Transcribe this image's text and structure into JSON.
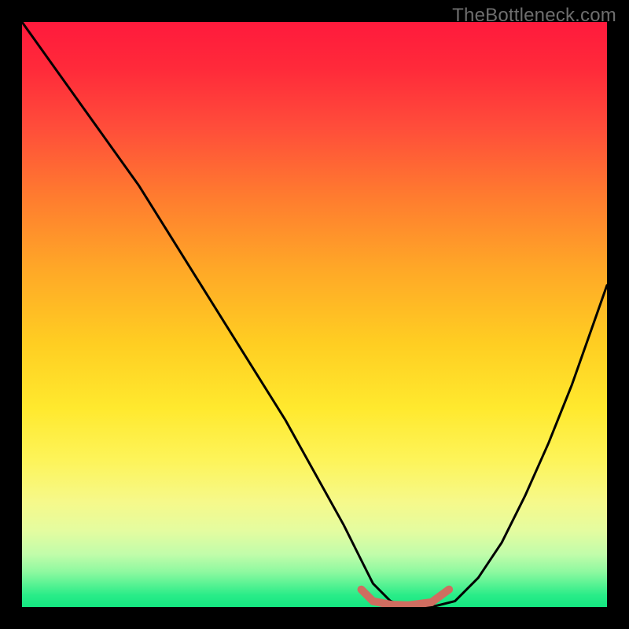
{
  "watermark": "TheBottleneck.com",
  "chart_data": {
    "type": "line",
    "title": "",
    "xlabel": "",
    "ylabel": "",
    "xlim": [
      0,
      100
    ],
    "ylim": [
      0,
      100
    ],
    "grid": false,
    "series": [
      {
        "name": "bottleneck-curve",
        "color": "#000000",
        "x": [
          0,
          5,
          10,
          15,
          20,
          25,
          30,
          35,
          40,
          45,
          50,
          55,
          58,
          60,
          63,
          66,
          70,
          74,
          78,
          82,
          86,
          90,
          94,
          100
        ],
        "values": [
          100,
          93,
          86,
          79,
          72,
          64,
          56,
          48,
          40,
          32,
          23,
          14,
          8,
          4,
          1,
          0,
          0,
          1,
          5,
          11,
          19,
          28,
          38,
          55
        ]
      },
      {
        "name": "optimal-band",
        "color": "#cf6d60",
        "x": [
          58,
          60,
          63,
          66,
          70,
          73
        ],
        "values": [
          3,
          1,
          0.4,
          0.3,
          0.8,
          3
        ]
      }
    ],
    "optimal_range_x": [
      58,
      73
    ],
    "background_gradient": {
      "top": "#ff1a3c",
      "mid": "#ffe92e",
      "bottom": "#14e781"
    }
  }
}
